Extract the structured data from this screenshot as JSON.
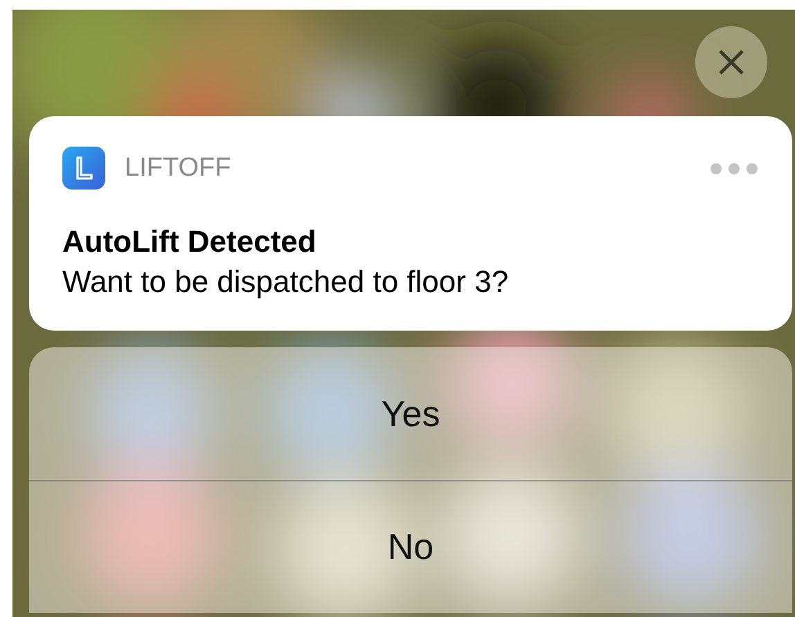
{
  "notification": {
    "app_name": "LIFTOFF",
    "title": "AutoLift Detected",
    "body": "Want to be dispatched to floor 3?"
  },
  "actions": [
    {
      "label": "Yes"
    },
    {
      "label": "No"
    }
  ]
}
